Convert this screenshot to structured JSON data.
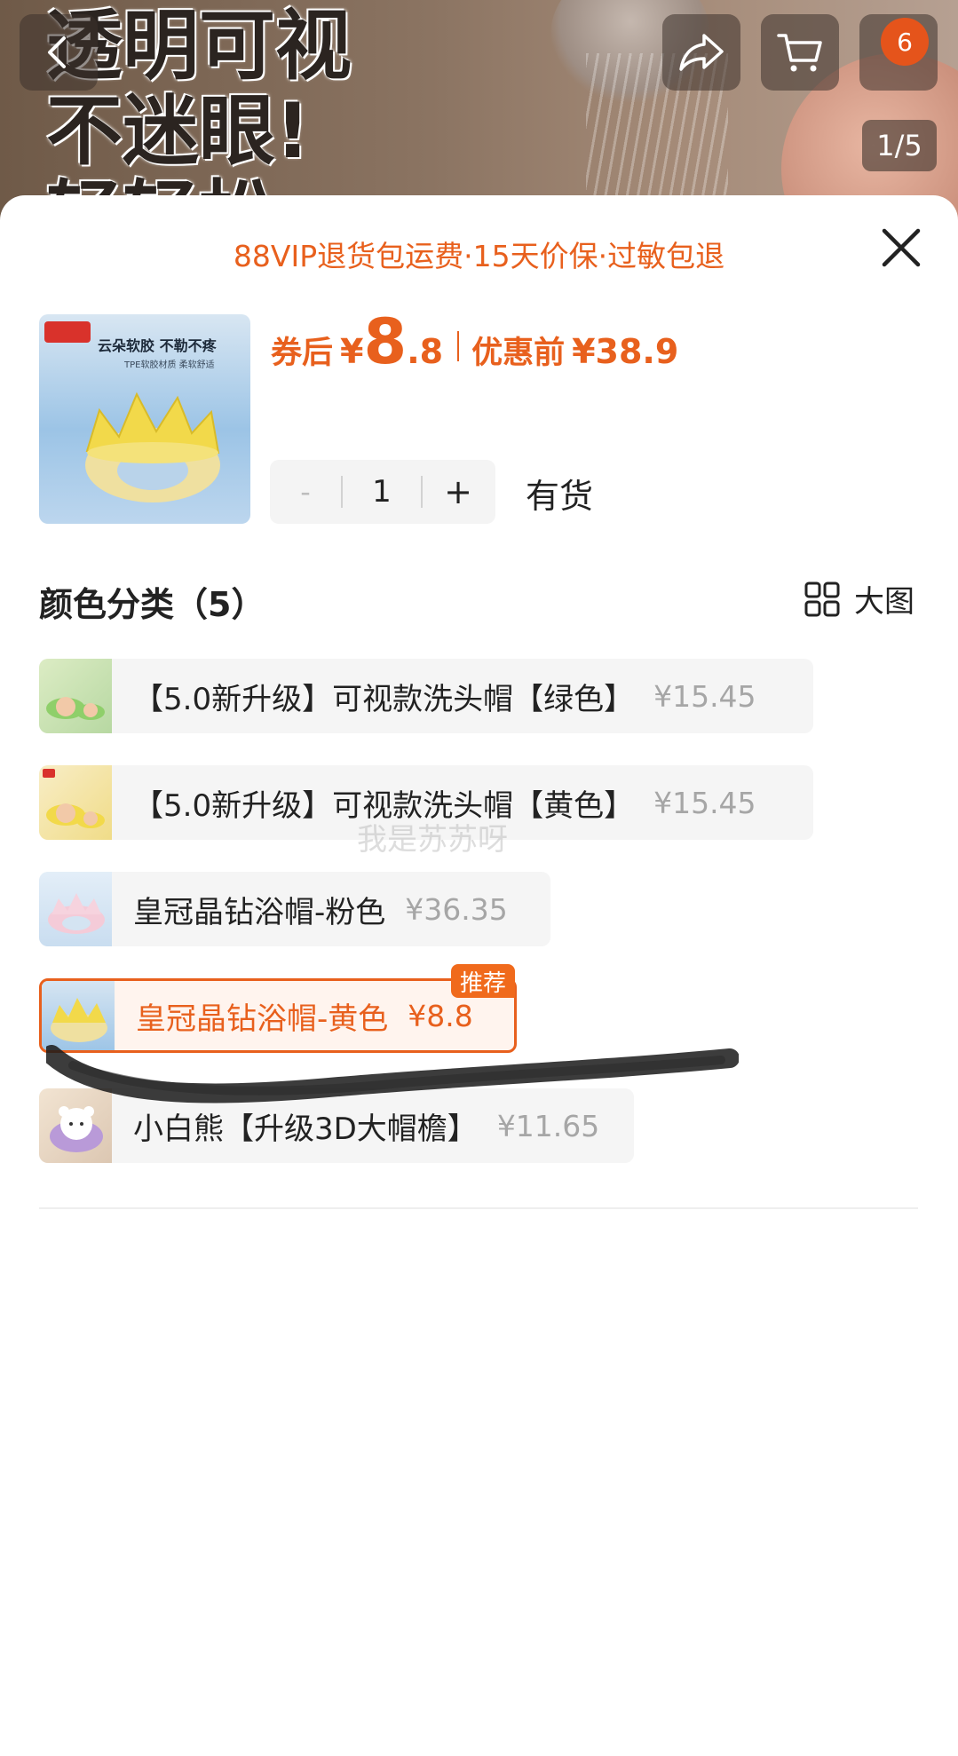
{
  "background": {
    "headline_lines": [
      "透明可视",
      "不迷眼!",
      "轻轻松…"
    ],
    "cart_badge": "6",
    "page_indicator": "1/5"
  },
  "sheet": {
    "promo": "88VIP退货包运费·15天价保·过敏包退",
    "product_thumb": {
      "brand": "",
      "tagline": "云朵软胶 不勒不疼",
      "subline": "TPE软胶材质 柔软舒适"
    },
    "price": {
      "after_coupon_label": "券后",
      "currency": "¥",
      "after_coupon_int": "8",
      "after_coupon_dec": ".8",
      "before_label": "优惠前",
      "before_value": "¥38.9"
    },
    "quantity": {
      "minus": "-",
      "value": "1",
      "plus": "+"
    },
    "stock_status": "有货",
    "section_title": "颜色分类（5）",
    "big_view_label": "大图",
    "options": [
      {
        "name": "【5.0新升级】可视款洗头帽【绿色】",
        "price": "¥15.45",
        "selected": false,
        "swatch": "#dcecc4",
        "width": 916
      },
      {
        "name": "【5.0新升级】可视款洗头帽【黄色】",
        "price": "¥15.45",
        "selected": false,
        "swatch": "#f4e4a6",
        "width": 916
      },
      {
        "name": "皇冠晶钻浴帽-粉色",
        "price": "¥36.35",
        "selected": false,
        "swatch": "#f2cfd9",
        "width": 576
      },
      {
        "name": "皇冠晶钻浴帽-黄色",
        "price": "¥8.8",
        "selected": true,
        "swatch": "#f2d94a",
        "width": 538
      },
      {
        "name": "小白熊【升级3D大帽檐】",
        "price": "¥11.65",
        "selected": false,
        "swatch": "#e9d7c6",
        "width": 670
      }
    ],
    "recommend_badge": "推荐",
    "watermark": "我是苏苏呀"
  },
  "colors": {
    "accent": "#e8601d",
    "muted_price": "#a6a6a6",
    "option_bg": "#f5f5f5"
  },
  "icons": [
    "back-icon",
    "share-icon",
    "cart-icon",
    "more-icon",
    "close-icon",
    "grid-icon"
  ]
}
